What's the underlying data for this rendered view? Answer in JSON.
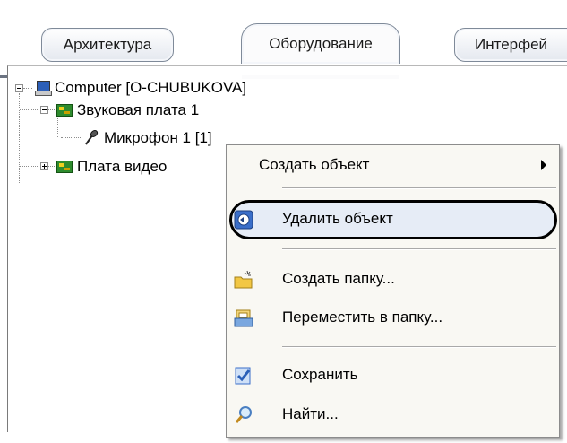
{
  "tabs": [
    {
      "label": "Архитектура",
      "active": false
    },
    {
      "label": "Оборудование",
      "active": true
    },
    {
      "label": "Интерфей",
      "active": false
    }
  ],
  "tree": {
    "root": {
      "label": "Computer [O-CHUBUKOVA]",
      "icon": "computer-icon"
    },
    "items": [
      {
        "label": "Звуковая плата 1",
        "icon": "board-icon"
      },
      {
        "label": "Микрофон 1 [1]",
        "icon": "microphone-icon"
      },
      {
        "label": "Плата видео",
        "icon": "board-icon"
      }
    ]
  },
  "context_menu": {
    "items": [
      {
        "label": "Создать объект",
        "has_submenu": true
      },
      {
        "label": "Удалить объект",
        "icon": "delete-object-icon",
        "highlighted": true
      },
      {
        "label": "Создать папку...",
        "icon": "new-folder-icon"
      },
      {
        "label": "Переместить в папку...",
        "icon": "move-to-folder-icon"
      },
      {
        "label": "Сохранить",
        "icon": "save-icon"
      },
      {
        "label": "Найти...",
        "icon": "search-icon"
      }
    ]
  },
  "colors": {
    "highlight_border": "#000000",
    "menu_bg": "#f9f8f3",
    "tab_border": "#7f8a99"
  }
}
